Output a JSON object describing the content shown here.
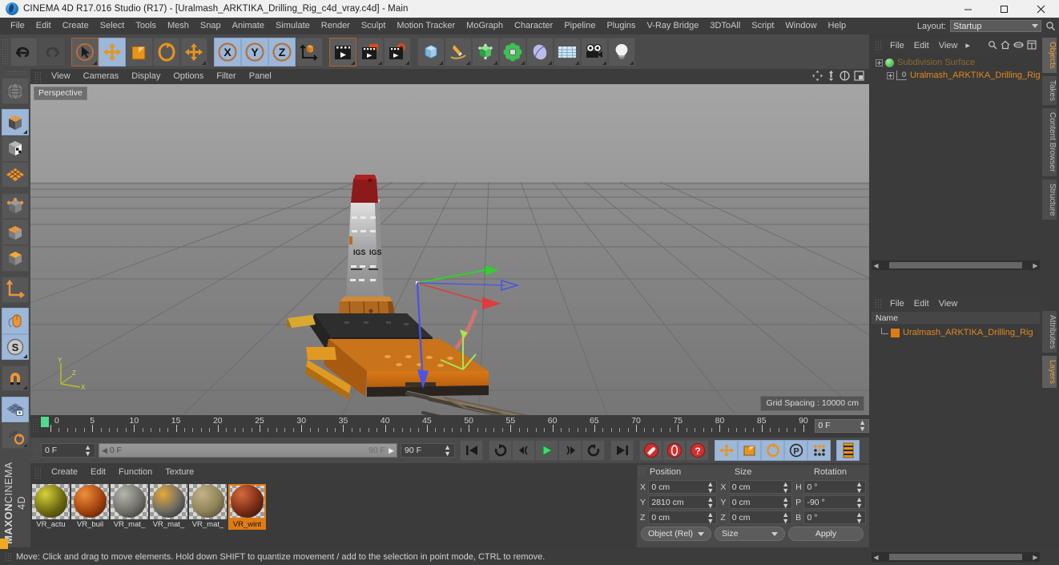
{
  "window": {
    "title": "CINEMA 4D R17.016 Studio (R17) - [Uralmash_ARKTIKA_Drilling_Rig_c4d_vray.c4d] - Main",
    "app_icon": "cinema4d-logo-icon",
    "minimize": "minimize-icon",
    "maximize": "maximize-icon",
    "close": "close-icon"
  },
  "menubar": {
    "items": [
      "File",
      "Edit",
      "Create",
      "Select",
      "Tools",
      "Mesh",
      "Snap",
      "Animate",
      "Simulate",
      "Render",
      "Sculpt",
      "Motion Tracker",
      "MoGraph",
      "Character",
      "Pipeline",
      "Plugins",
      "V-Ray Bridge",
      "3DToAll",
      "Script",
      "Window",
      "Help"
    ],
    "layout_label": "Layout:",
    "layout_value": "Startup",
    "search_icon": "search-icon"
  },
  "toolbar": {
    "buttons": [
      {
        "name": "undo-button",
        "icon": "undo-arrow-icon",
        "state": "normal"
      },
      {
        "name": "redo-button",
        "icon": "redo-arrow-icon",
        "state": "disabled"
      },
      {
        "name": "live-selection-tool",
        "icon": "cursor-circle-icon",
        "state": "selected"
      },
      {
        "name": "move-tool",
        "icon": "move-arrows-icon",
        "state": "active"
      },
      {
        "name": "scale-tool",
        "icon": "scale-square-icon",
        "state": "normal"
      },
      {
        "name": "rotate-tool",
        "icon": "rotate-ring-icon",
        "state": "normal"
      },
      {
        "name": "free-transform-tool",
        "icon": "move-arrows-icon",
        "state": "normal"
      },
      {
        "name": "lock-x-axis",
        "icon": "axis-x-icon",
        "state": "active"
      },
      {
        "name": "lock-y-axis",
        "icon": "axis-y-icon",
        "state": "active"
      },
      {
        "name": "lock-z-axis",
        "icon": "axis-z-icon",
        "state": "active"
      },
      {
        "name": "world-object-coords",
        "icon": "world-axis-cube-icon",
        "state": "normal"
      },
      {
        "name": "render-view",
        "icon": "render-clapper-icon",
        "state": "selected"
      },
      {
        "name": "render-region",
        "icon": "render-clapper-region-icon",
        "state": "normal"
      },
      {
        "name": "render-settings",
        "icon": "render-settings-gear-icon",
        "state": "normal"
      },
      {
        "name": "add-primitive",
        "icon": "cube-blue-icon",
        "state": "normal"
      },
      {
        "name": "add-spline",
        "icon": "pen-spline-icon",
        "state": "normal"
      },
      {
        "name": "add-generator",
        "icon": "generator-green-icon",
        "state": "normal"
      },
      {
        "name": "add-deformer",
        "icon": "deformer-cluster-icon",
        "state": "normal"
      },
      {
        "name": "add-scene-object",
        "icon": "environment-blob-icon",
        "state": "normal"
      },
      {
        "name": "add-floor",
        "icon": "floor-grid-icon",
        "state": "normal"
      },
      {
        "name": "add-camera",
        "icon": "camera-icon",
        "state": "normal"
      },
      {
        "name": "add-light",
        "icon": "light-bulb-icon",
        "state": "normal"
      }
    ]
  },
  "left_toolbar": {
    "buttons": [
      {
        "name": "make-editable",
        "icon": "sphere-wireframe-icon",
        "state": "normal"
      },
      {
        "name": "model-mode",
        "icon": "cube-mode-icon",
        "state": "active"
      },
      {
        "name": "texture-mode",
        "icon": "texture-checker-cube-icon",
        "state": "normal"
      },
      {
        "name": "polygon-grid-mode",
        "icon": "polygon-grid-icon",
        "state": "normal"
      },
      {
        "name": "points-mode",
        "icon": "points-cube-icon",
        "state": "normal"
      },
      {
        "name": "edges-mode",
        "icon": "edges-cube-icon",
        "state": "normal"
      },
      {
        "name": "polygons-mode",
        "icon": "polygons-cube-icon",
        "state": "normal"
      },
      {
        "name": "axis-mode",
        "icon": "axis-corner-icon",
        "state": "normal"
      },
      {
        "name": "viewport-mouse",
        "icon": "mouse-icon",
        "state": "active"
      },
      {
        "name": "soft-selection",
        "icon": "s-circle-icon",
        "state": "active"
      },
      {
        "name": "magnet-tool",
        "icon": "magnet-icon",
        "state": "normal"
      },
      {
        "name": "workplane-lock",
        "icon": "grid-lock-icon",
        "state": "active"
      },
      {
        "name": "workplane-rotate",
        "icon": "grid-rotate-icon",
        "state": "normal"
      }
    ],
    "brand_top": "MAXON",
    "brand_bottom": "CINEMA 4D"
  },
  "viewport": {
    "menu": [
      "View",
      "Cameras",
      "Display",
      "Options",
      "Filter",
      "Panel"
    ],
    "corner_icons": [
      "pan-view-icon",
      "dolly-view-icon",
      "rotate-view-icon",
      "maximize-view-icon"
    ],
    "perspective_label": "Perspective",
    "grid_spacing": "Grid Spacing : 10000 cm",
    "axis_hud": {
      "y": "Y",
      "x": "X",
      "z": "Z"
    },
    "scene": {
      "object": "Uralmash ARKTIKA Drilling Rig",
      "gizmo": "move-axis-gizmo",
      "gizmo_axes": [
        "red-x-arrow",
        "green-y-arrow",
        "blue-z-arrow"
      ]
    }
  },
  "timeline": {
    "ticks": [
      0,
      5,
      10,
      15,
      20,
      25,
      30,
      35,
      40,
      45,
      50,
      55,
      60,
      65,
      70,
      75,
      80,
      85,
      90
    ],
    "start": 0,
    "end": 90,
    "current_frame_box": "0 F",
    "playhead": 0
  },
  "playback": {
    "current_frame": "0 F",
    "range_start": "0 F",
    "range_end": "90 F",
    "end_frame": "90 F",
    "buttons": [
      {
        "name": "go-to-start-button",
        "icon": "skip-start-icon",
        "state": "normal"
      },
      {
        "name": "loop-button",
        "icon": "loop-icon",
        "state": "normal"
      },
      {
        "name": "step-back-button",
        "icon": "step-back-icon",
        "state": "normal"
      },
      {
        "name": "play-button",
        "icon": "play-triangle-icon",
        "state": "normal"
      },
      {
        "name": "step-forward-button",
        "icon": "step-forward-icon",
        "state": "normal"
      },
      {
        "name": "play-reverse-button",
        "icon": "loop-reverse-icon",
        "state": "normal"
      },
      {
        "name": "go-to-end-button",
        "icon": "skip-end-icon",
        "state": "normal"
      },
      {
        "name": "record-key-button",
        "icon": "record-key-icon",
        "state": "normal"
      },
      {
        "name": "autokey-button",
        "icon": "autokey-icon",
        "state": "normal"
      },
      {
        "name": "keyframe-help-button",
        "icon": "question-key-icon",
        "state": "normal"
      },
      {
        "name": "record-position-button",
        "icon": "position-key-icon",
        "state": "active"
      },
      {
        "name": "record-scale-button",
        "icon": "scale-key-icon",
        "state": "active"
      },
      {
        "name": "record-rotation-button",
        "icon": "rotation-key-icon",
        "state": "active"
      },
      {
        "name": "record-param-button",
        "icon": "param-key-icon",
        "state": "active"
      },
      {
        "name": "record-pla-button",
        "icon": "pla-dots-icon",
        "state": "active"
      },
      {
        "name": "timeline-view-button",
        "icon": "timeline-strip-icon",
        "state": "active"
      }
    ]
  },
  "material_manager": {
    "menu": [
      "Create",
      "Edit",
      "Function",
      "Texture"
    ],
    "materials": [
      {
        "label": "VR_actu",
        "selected": false,
        "c1": "#d8d23a",
        "c2": "#6e6a12",
        "c3": "#2e2c08"
      },
      {
        "label": "VR_buil",
        "selected": false,
        "c1": "#f0903a",
        "c2": "#a3420e",
        "c3": "#3a1204"
      },
      {
        "label": "VR_mat_",
        "selected": false,
        "c1": "#b6b6ac",
        "c2": "#6f6f68",
        "c3": "#2a2a26"
      },
      {
        "label": "VR_mat_",
        "selected": false,
        "c1": "#e8a83c",
        "c2": "#6a6a64",
        "c3": "#201f1d"
      },
      {
        "label": "VR_mat_",
        "selected": false,
        "c1": "#c3b487",
        "c2": "#8e8258",
        "c3": "#3c3726"
      },
      {
        "label": "VR_wint",
        "selected": true,
        "c1": "#d66a3c",
        "c2": "#7a2c16",
        "c3": "#241008"
      }
    ]
  },
  "coordinates": {
    "headers": {
      "position": "Position",
      "size": "Size",
      "rotation": "Rotation"
    },
    "axis_labels": {
      "x": "X",
      "y": "Y",
      "z": "Z",
      "h": "H",
      "p": "P",
      "b": "B"
    },
    "position": {
      "x": "0 cm",
      "y": "2810 cm",
      "z": "0 cm"
    },
    "size": {
      "x": "0 cm",
      "y": "0 cm",
      "z": "0 cm"
    },
    "rotation": {
      "h": "0 °",
      "p": "-90 °",
      "b": "0 °"
    },
    "mode_select": "Object (Rel)",
    "size_select": "Size",
    "apply_button": "Apply"
  },
  "object_manager": {
    "menu": [
      "File",
      "Edit",
      "View"
    ],
    "menu_arrow": "chevron-right-icon",
    "icons": [
      "search-icon",
      "home-icon",
      "link-icon",
      "fit-icon"
    ],
    "rows": [
      {
        "label": "Subdivision Surface",
        "icon": "subdivision-surface-icon",
        "dim": true,
        "indent": 0
      },
      {
        "label": "Uralmash_ARKTIKA_Drilling_Rig",
        "icon": "level-zero-icon",
        "dim": false,
        "indent": 1
      }
    ]
  },
  "layer_manager": {
    "menu": [
      "File",
      "Edit",
      "View"
    ],
    "column_header": "Name",
    "rows": [
      {
        "label": "Uralmash_ARKTIKA_Drilling_Rig",
        "icon": "layer-color-swatch-icon"
      }
    ]
  },
  "vertical_tabs_top": [
    {
      "label": "Objects",
      "active": true
    },
    {
      "label": "Takes",
      "active": false
    },
    {
      "label": "Content Browser",
      "active": false
    },
    {
      "label": "Structure",
      "active": false
    }
  ],
  "vertical_tabs_bottom": [
    {
      "label": "Attributes",
      "active": false
    },
    {
      "label": "Layers",
      "active": true
    }
  ],
  "statusbar": {
    "text": "Move: Click and drag to move elements. Hold down SHIFT to quantize movement / add to the selection in point mode, CTRL to remove."
  },
  "colors": {
    "accent_orange": "#e08a1e",
    "selected_blue": "#9cb7d8",
    "panel_bg": "#3b3b3b",
    "toolbar_bg": "#4a4a4a",
    "axis_x": "#e03b3b",
    "axis_y": "#3bd43b",
    "axis_z": "#3b4fe0"
  }
}
